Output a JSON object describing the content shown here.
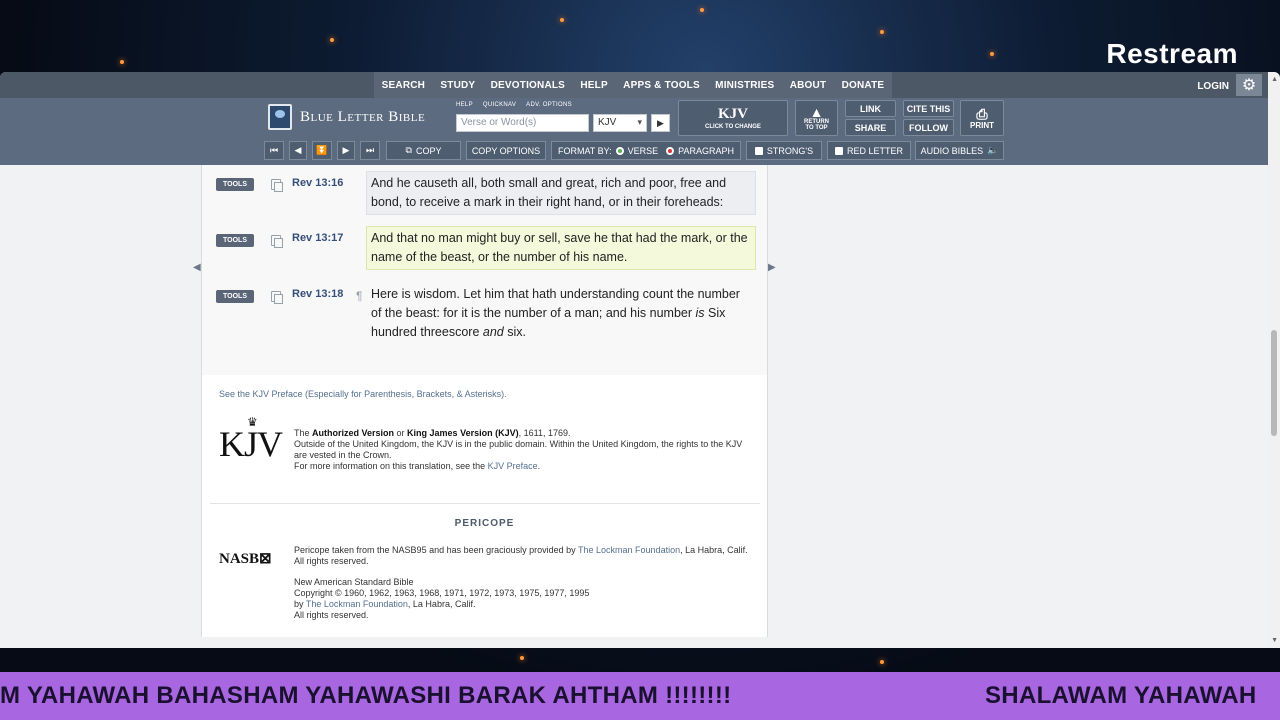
{
  "stream": {
    "brand": "Restream"
  },
  "topnav": {
    "items": [
      "SEARCH",
      "STUDY",
      "DEVOTIONALS",
      "HELP",
      "APPS & TOOLS",
      "MINISTRIES",
      "ABOUT",
      "DONATE"
    ],
    "login": "LOGIN",
    "gear_icon": "gear-icon"
  },
  "header": {
    "logo_text": "Blue Letter Bible",
    "mini_links": [
      "HELP",
      "QUICKNAV",
      "ADV. OPTIONS"
    ],
    "search_placeholder": "Verse or Word(s)",
    "version_value": "KJV",
    "kjv_button": {
      "label": "KJV",
      "sub": "CLICK TO CHANGE"
    },
    "return_to_top": {
      "line1": "RETURN",
      "line2": "TO TOP"
    },
    "link": "LINK",
    "share": "SHARE",
    "cite": "CITE THIS",
    "follow": "FOLLOW",
    "print": "PRINT"
  },
  "toolbar": {
    "copy": "COPY",
    "copy_options": "COPY OPTIONS",
    "format_by": "FORMAT BY:",
    "verse": "VERSE",
    "paragraph": "PARAGRAPH",
    "strongs": "STRONG'S",
    "red_letter": "RED LETTER",
    "audio_bibles": "AUDIO BIBLES"
  },
  "verses": [
    {
      "tools": "TOOLS",
      "ref": "Rev 13:16",
      "text": "And he causeth all, both small and great, rich and poor, free and bond, to receive a mark in their right hand, or in their foreheads:"
    },
    {
      "tools": "TOOLS",
      "ref": "Rev 13:17",
      "text": "And that no man might buy or sell, save he that had the mark, or the name of the beast, or the number of his name."
    },
    {
      "tools": "TOOLS",
      "ref": "Rev 13:18",
      "pilcrow": "¶",
      "text_a": "Here is wisdom. Let him that hath understanding count the number of the beast: for it is the number of a man; and his number ",
      "text_is": "is",
      "text_b": " Six hundred threescore ",
      "text_and": "and",
      "text_c": " six."
    }
  ],
  "footer": {
    "preface_link": "See the KJV Preface (Especially for Parenthesis, Brackets, & Asterisks).",
    "kjv_logo": "KJV",
    "kjv_the": "The ",
    "kjv_av": "Authorized Version",
    "kjv_or": " or ",
    "kjv_kjv": "King James Version (KJV)",
    "kjv_dates": ", 1611, 1769.",
    "kjv_line2": "Outside of the United Kingdom, the KJV is in the public domain. Within the United Kingdom, the rights to the KJV are vested in the Crown.",
    "kjv_line3": "For more information on this translation, see the ",
    "kjv_preface": "KJV Preface",
    "kjv_period": ".",
    "pericope_title": "PERICOPE",
    "nasb_logo": "NASB",
    "nasb_line1a": "Pericope taken from the NASB95 and has been graciously provided by ",
    "lockman": "The Lockman Foundation",
    "nasb_line1b": ", La Habra, Calif. All rights reserved.",
    "nasb_title": "New American Standard Bible",
    "nasb_copyright": "Copyright © 1960, 1962, 1963, 1968, 1971, 1972, 1973, 1975, 1977, 1995",
    "nasb_by": "by ",
    "nasb_city": ", La Habra, Calif.",
    "nasb_rights": "All rights reserved."
  },
  "ticker": {
    "text_left": "M YAHAWAH BAHASHAM YAHAWASHI BARAK AHTHAM !!!!!!!!",
    "text_right": "SHALAWAM YAHAWAH"
  },
  "colors": {
    "nav": "#4d5866",
    "header": "#5d6b80",
    "ref": "#34507a",
    "ticker": "#a866e0"
  }
}
